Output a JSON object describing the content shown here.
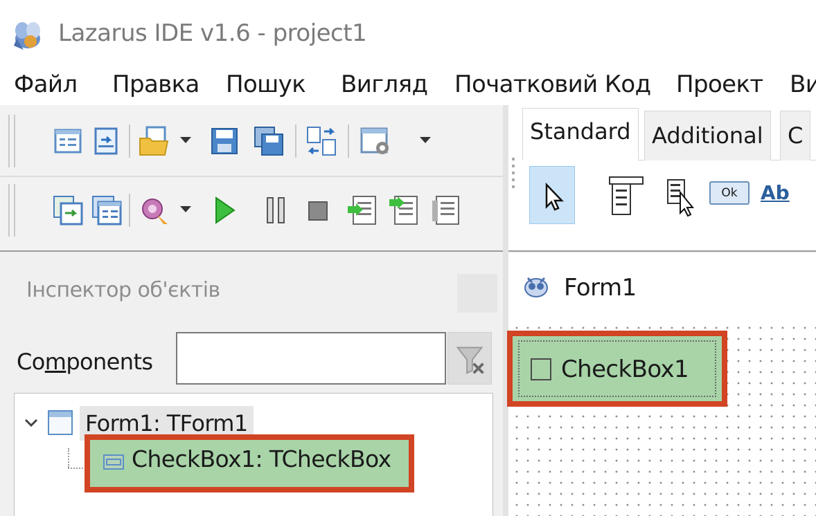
{
  "window": {
    "title": "Lazarus IDE v1.6 - project1"
  },
  "menu": {
    "items": [
      "Файл",
      "Правка",
      "Пошук",
      "Вигляд",
      "Початковий Код",
      "Проект",
      "Ви"
    ]
  },
  "palette": {
    "tabs": [
      "Standard",
      "Additional",
      "C"
    ],
    "tool_text_ok": "Ok",
    "tool_text_ab": "Ab"
  },
  "inspector": {
    "title": "Інспектор об'єктів",
    "components_label_pre": "Co",
    "components_label_u": "m",
    "components_label_post": "ponents",
    "components_value": "",
    "tree": [
      {
        "label": "Form1: TForm1"
      },
      {
        "label": "CheckBox1: TCheckBox"
      }
    ]
  },
  "designer": {
    "form_title": "Form1",
    "checkbox_caption": "CheckBox1"
  },
  "colors": {
    "highlight_border": "#d14424",
    "selection_fill": "#a8d4a8"
  }
}
